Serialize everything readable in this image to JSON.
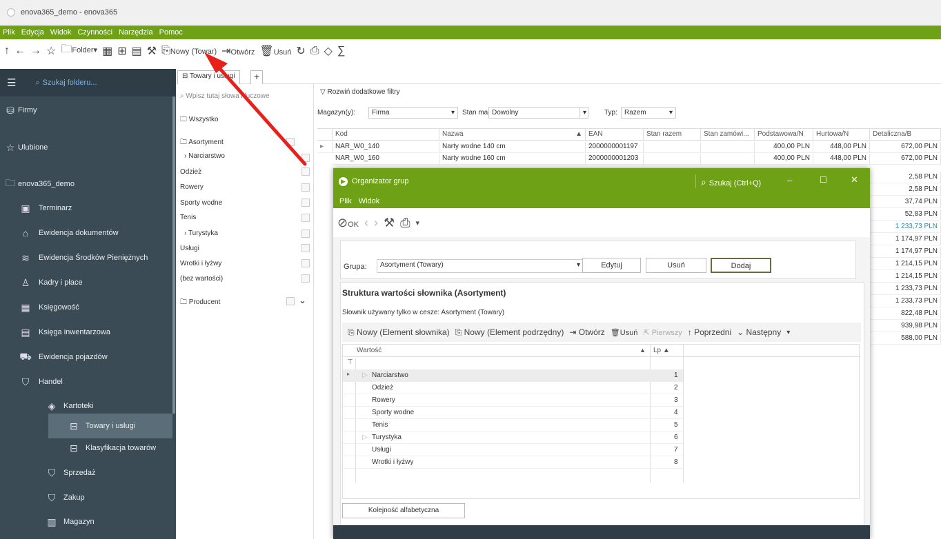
{
  "window": {
    "title": "enova365_demo - enova365"
  },
  "menu": [
    "Plik",
    "Edycja",
    "Widok",
    "Czynności",
    "Narzędzia",
    "Pomoc"
  ],
  "toolbar": {
    "folder": "Folder",
    "new": "Nowy (Towar)",
    "open": "Otwórz",
    "delete": "Usuń"
  },
  "sidebar": {
    "search_placeholder": "Szukaj folderu...",
    "items": [
      {
        "label": "Firmy",
        "icon": "database-icon"
      },
      {
        "label": "Ulubione",
        "icon": "star-icon"
      },
      {
        "label": "enova365_demo",
        "icon": "folder-icon"
      },
      {
        "label": "Terminarz",
        "icon": "calendar-icon"
      },
      {
        "label": "Ewidencja dokumentów",
        "icon": "inbox-icon"
      },
      {
        "label": "Ewidencja Środków Pieniężnych",
        "icon": "money-icon"
      },
      {
        "label": "Kadry i płace",
        "icon": "people-icon"
      },
      {
        "label": "Księgowość",
        "icon": "calculator-icon"
      },
      {
        "label": "Księga inwentarzowa",
        "icon": "book-icon"
      },
      {
        "label": "Ewidencja pojazdów",
        "icon": "car-icon"
      },
      {
        "label": "Handel",
        "icon": "cart-icon"
      },
      {
        "label": "Kartoteki",
        "icon": "layers-icon"
      },
      {
        "label": "Towary i usługi",
        "icon": "gift-icon"
      },
      {
        "label": "Klasyfikacja towarów",
        "icon": "gift-icon"
      },
      {
        "label": "Sprzedaż",
        "icon": "cart-icon"
      },
      {
        "label": "Zakup",
        "icon": "cart-icon"
      },
      {
        "label": "Magazyn",
        "icon": "warehouse-icon"
      }
    ]
  },
  "tab": {
    "label": "Towary i usługi"
  },
  "keywords": {
    "placeholder": "Wpisz tutaj słowa kluczowe",
    "all": "Wszystko",
    "assortment": "Asortyment",
    "items": [
      "Narciarstwo",
      "Odzież",
      "Rowery",
      "Sporty wodne",
      "Tenis",
      "Turystyka",
      "Usługi",
      "Wrotki i łyżwy",
      "(bez wartości)"
    ],
    "producer": "Producent"
  },
  "filters": {
    "expand": "Rozwiń dodatkowe filtry",
    "warehouse_label": "Magazyn(y):",
    "warehouse_value": "Firma",
    "stock_label": "Stan mag.:",
    "stock_value": "Dowolny",
    "type_label": "Typ:",
    "type_value": "Razem"
  },
  "grid": {
    "columns": [
      "Kod",
      "Nazwa",
      "EAN",
      "Stan razem",
      "Stan zamówi...",
      "Podstawowa/N",
      "Hurtowa/N",
      "Detaliczna/B"
    ],
    "rows": [
      {
        "kod": "NAR_W0_140",
        "nazwa": "Narty wodne 140 cm",
        "ean": "2000000001197",
        "podst": "400,00 PLN",
        "hurt": "448,00 PLN",
        "det": "672,00 PLN"
      },
      {
        "kod": "NAR_W0_160",
        "nazwa": "Narty wodne 160 cm",
        "ean": "2000000001203",
        "podst": "400,00 PLN",
        "hurt": "448,00 PLN",
        "det": "672,00 PLN"
      }
    ],
    "extra_retail": [
      "2,58 PLN",
      "2,58 PLN",
      "37,74 PLN",
      "52,83 PLN",
      "1 233,73 PLN",
      "1 174,97 PLN",
      "1 174,97 PLN",
      "1 214,15 PLN",
      "1 214,15 PLN",
      "1 233,73 PLN",
      "1 233,73 PLN",
      "822,48 PLN",
      "939,98 PLN",
      "588,00 PLN"
    ]
  },
  "dialog": {
    "title": "Organizator grup",
    "search": "Szukaj (Ctrl+Q)",
    "menu": [
      "Plik",
      "Widok"
    ],
    "ok": "OK",
    "group_label": "Grupa:",
    "group_value": "Asortyment (Towary)",
    "edit": "Edytuj",
    "remove": "Usuń",
    "add": "Dodaj",
    "section_title": "Struktura wartości słownika (Asortyment)",
    "section_subtitle": "Słownik używany tylko w cesze: Asortyment (Towary)",
    "tb": {
      "new_elem": "Nowy (Element słownika)",
      "new_sub": "Nowy (Element podrzędny)",
      "open": "Otwórz",
      "delete": "Usuń",
      "first": "Pierwszy",
      "prev": "Poprzedni",
      "next": "Następny"
    },
    "columns": {
      "value": "Wartość",
      "lp": "Lp"
    },
    "values": [
      {
        "v": "Narciarstwo",
        "lp": "1"
      },
      {
        "v": "Odzież",
        "lp": "2"
      },
      {
        "v": "Rowery",
        "lp": "3"
      },
      {
        "v": "Sporty wodne",
        "lp": "4"
      },
      {
        "v": "Tenis",
        "lp": "5"
      },
      {
        "v": "Turystyka",
        "lp": "6"
      },
      {
        "v": "Usługi",
        "lp": "7"
      },
      {
        "v": "Wrotki i łyżwy",
        "lp": "8"
      }
    ],
    "alpha": "Kolejność alfabetyczna"
  },
  "colors": {
    "brand": "#6ea116",
    "sidebar": "#3b4b56",
    "arrow": "#e8201c"
  }
}
